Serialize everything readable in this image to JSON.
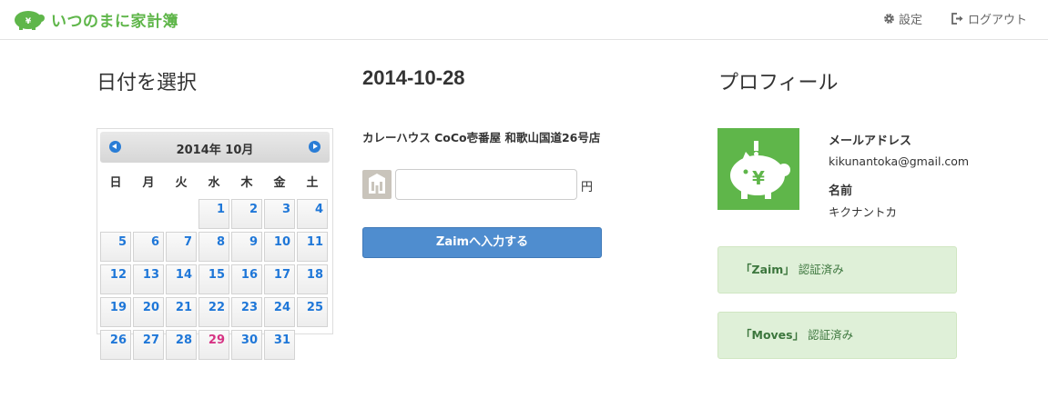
{
  "header": {
    "brand": "いつのまに家計簿",
    "brand_icon": "piggy-bank-icon",
    "settings_label": "設定",
    "logout_label": "ログアウト"
  },
  "calendar": {
    "section_title": "日付を選択",
    "month_title": "2014年 10月",
    "weekdays": [
      "日",
      "月",
      "火",
      "水",
      "木",
      "金",
      "土"
    ],
    "weeks": [
      [
        "",
        "",
        "",
        "1",
        "2",
        "3",
        "4"
      ],
      [
        "5",
        "6",
        "7",
        "8",
        "9",
        "10",
        "11"
      ],
      [
        "12",
        "13",
        "14",
        "15",
        "16",
        "17",
        "18"
      ],
      [
        "19",
        "20",
        "21",
        "22",
        "23",
        "24",
        "25"
      ],
      [
        "26",
        "27",
        "28",
        "29",
        "30",
        "31",
        ""
      ]
    ],
    "highlighted_day": "29",
    "highlight_color": "#d63384",
    "day_color": "#1f77d8"
  },
  "entry": {
    "date_title": "2014-10-28",
    "shop_name": "カレーハウス CoCo壱番屋 和歌山国道26号店",
    "amount_value": "",
    "amount_unit": "円",
    "submit_label": "Zaimへ入力する"
  },
  "profile": {
    "section_title": "プロフィール",
    "email_label": "メールアドレス",
    "email": "kikunantoka@gmail.com",
    "name_label": "名前",
    "name": "キクナントカ",
    "auth": [
      {
        "service": "「Zaim」",
        "status": "認証済み"
      },
      {
        "service": "「Moves」",
        "status": "認証済み"
      }
    ]
  },
  "colors": {
    "brand_green": "#5fb64a",
    "button_blue": "#4f8dcf",
    "success_bg": "#dff0d8"
  }
}
